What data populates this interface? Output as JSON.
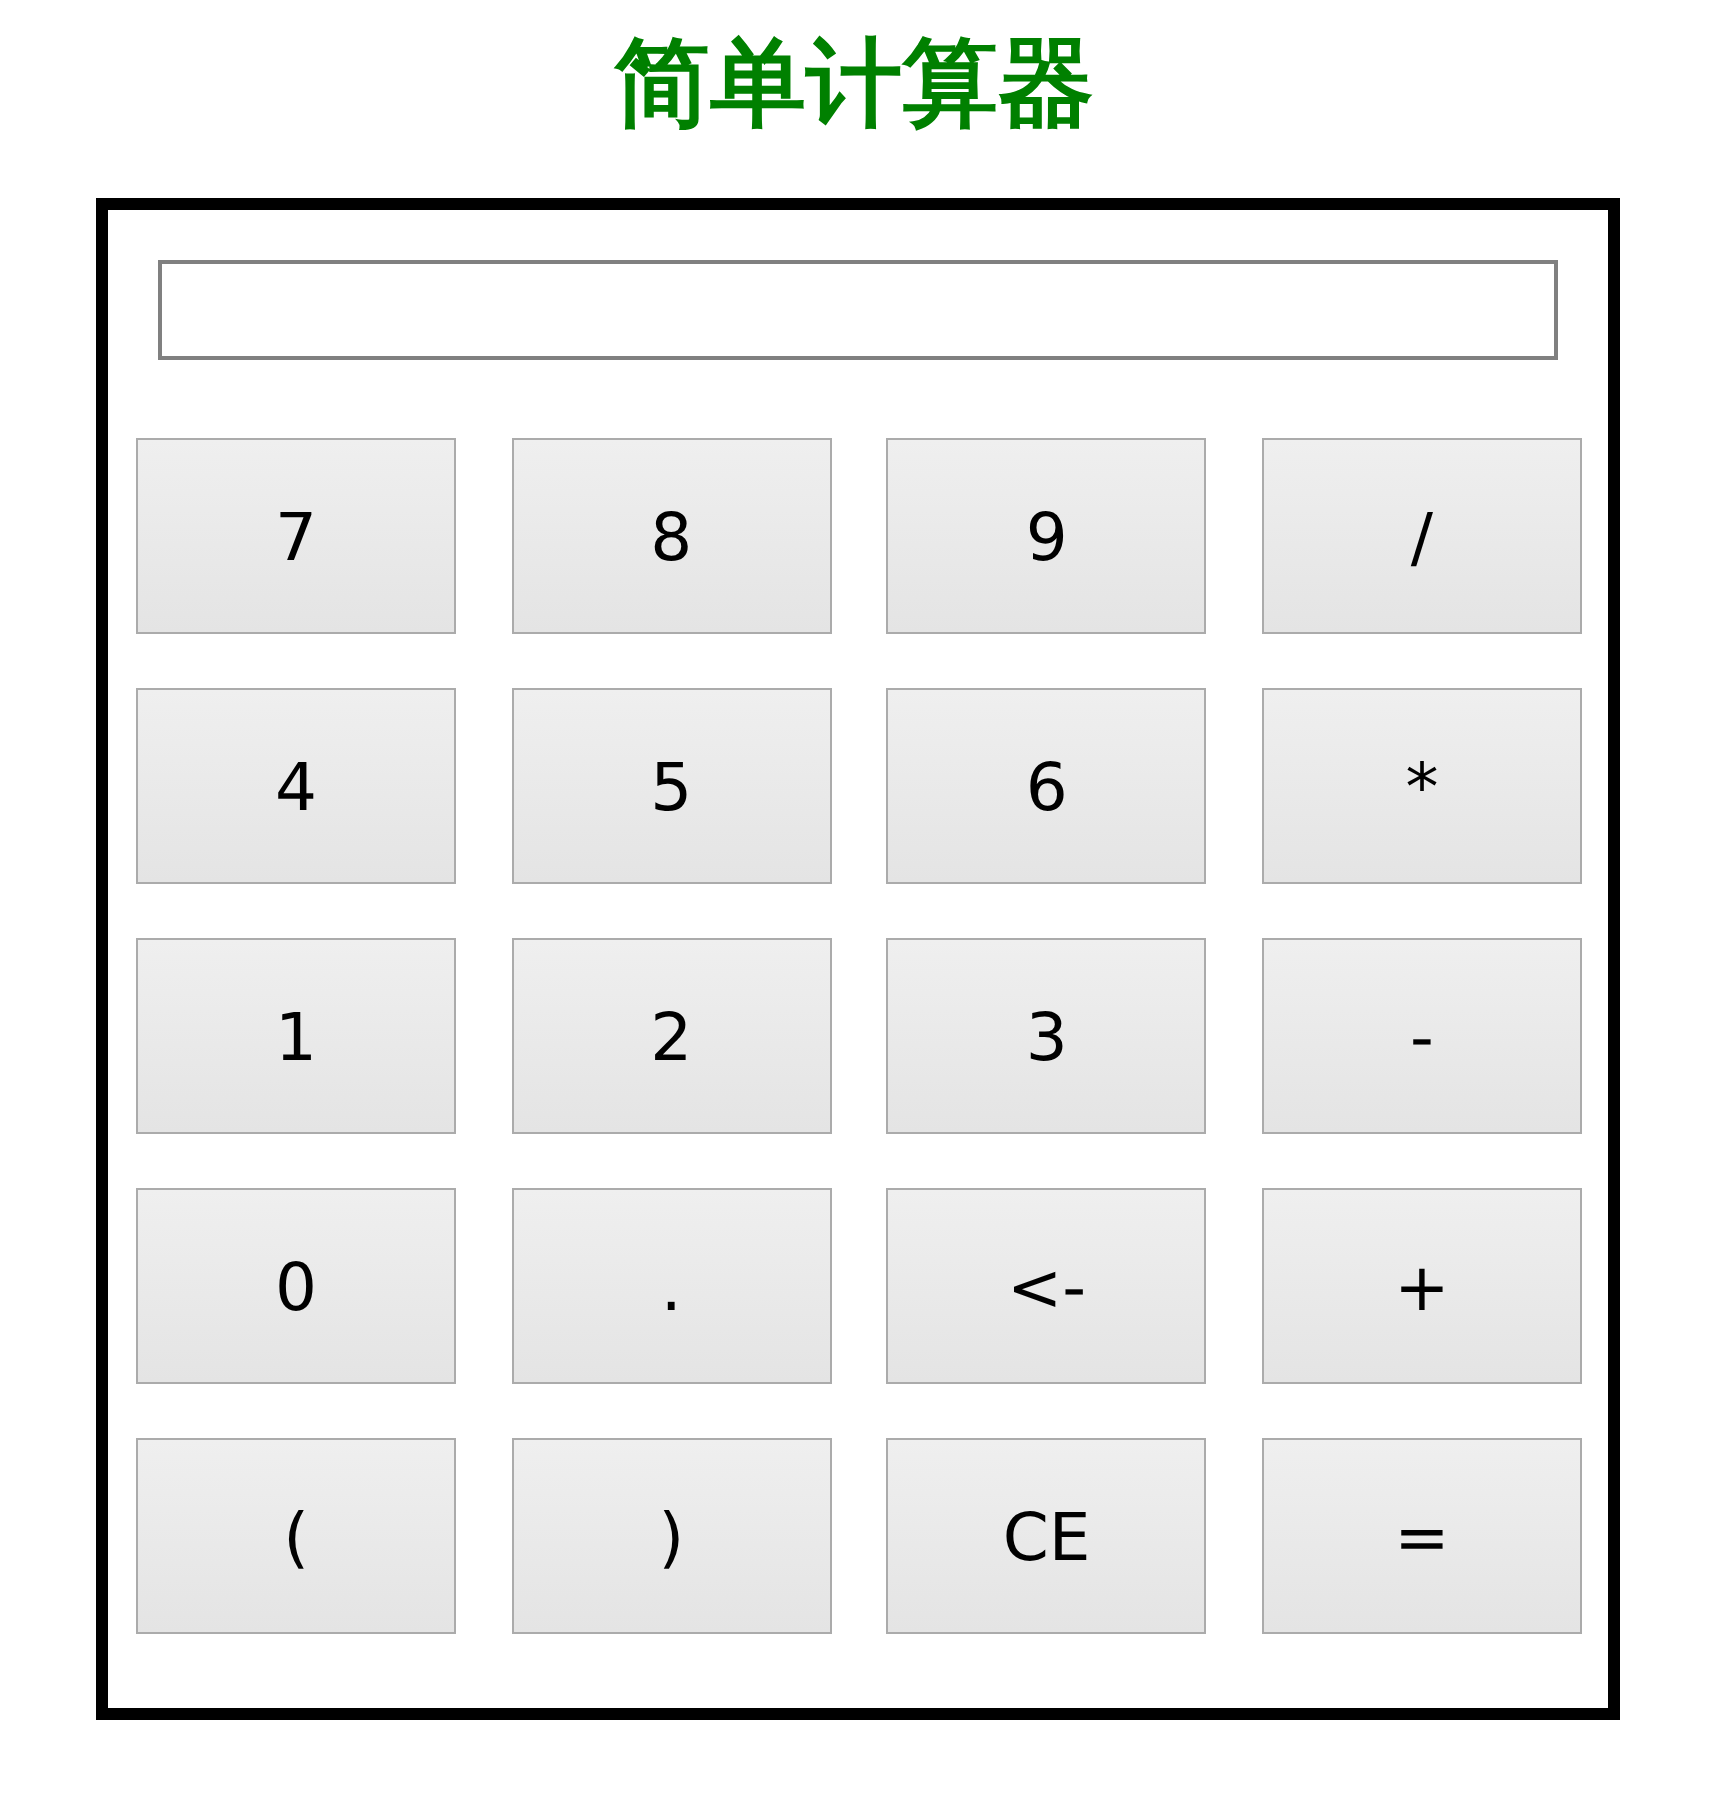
{
  "title": "简单计算器",
  "keys": [
    "7",
    "8",
    "9",
    "/",
    "4",
    "5",
    "6",
    "*",
    "1",
    "2",
    "3",
    "-",
    "0",
    ".",
    "<-",
    "+",
    "(",
    ")",
    "CE",
    "="
  ]
}
